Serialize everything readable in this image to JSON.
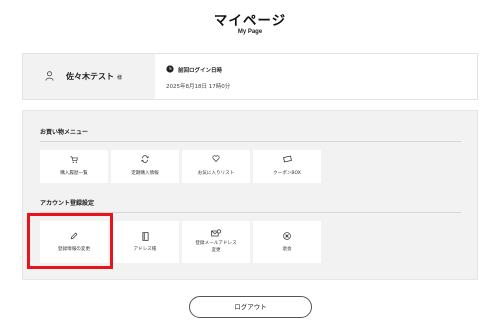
{
  "header": {
    "title": "マイページ",
    "subtitle": "My Page"
  },
  "user": {
    "name": "佐々木テスト",
    "honorific": "様",
    "last_login_label": "前回ログイン日時",
    "last_login_value": "2025年8月18日 17時0分"
  },
  "shopping_menu": {
    "title": "お買い物メニュー",
    "items": [
      {
        "label": "購入履歴一覧",
        "icon": "cart-icon"
      },
      {
        "label": "定期購入情報",
        "icon": "repeat-icon"
      },
      {
        "label": "お気に入りリスト",
        "icon": "heart-icon"
      },
      {
        "label": "クーポンBOX",
        "icon": "coupon-icon"
      }
    ]
  },
  "account_menu": {
    "title": "アカウント登録設定",
    "items": [
      {
        "label": "登録情報の変更",
        "icon": "pencil-icon"
      },
      {
        "label": "アドレス帳",
        "icon": "address-book-icon"
      },
      {
        "label": "登録メールアドレス",
        "label2": "変更",
        "icon": "mail-settings-icon"
      },
      {
        "label": "退会",
        "icon": "close-circle-icon"
      }
    ]
  },
  "highlight": {
    "color": "#e8141c",
    "target": "登録情報の変更"
  },
  "logout": {
    "label": "ログアウト"
  }
}
